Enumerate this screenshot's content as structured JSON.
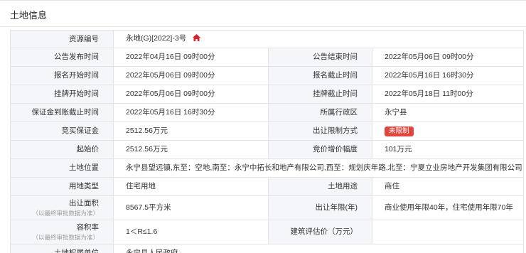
{
  "page": {
    "title": "土地信息"
  },
  "rows": [
    {
      "l1": "资源编号",
      "v1": "永地(G)[2022]-3号"
    },
    {
      "l1": "公告发布时间",
      "v1": "2022年04月16日 09时00分",
      "l2": "公告结束时间",
      "v2": "2022年05月06日 09时00分"
    },
    {
      "l1": "报名开始时间",
      "v1": "2022年05月06日 09时00分",
      "l2": "报名截止时间",
      "v2": "2022年05月16日 16时30分"
    },
    {
      "l1": "挂牌开始时间",
      "v1": "2022年05月06日 09时00分",
      "l2": "挂牌截止时间",
      "v2": "2022年05月18日 11时00分"
    },
    {
      "l1": "保证金到账截止时间",
      "v1": "2022年05月16日 16时30分",
      "l2": "所属行政区",
      "v2": "永宁县"
    },
    {
      "l1": "竞买保证金",
      "v1": "2512.56万元",
      "l2": "出让限制方式",
      "v2": "未限制"
    },
    {
      "l1": "起始价",
      "v1": "2512.56万元",
      "l2": "竞价增价幅度",
      "v2": "101万元"
    },
    {
      "l1": "土地位置",
      "v1": "永宁县望远镇,东至：空地,南至：永宁中拓长和地产有限公司,西至：规划庆年路,北至：宁夏立业房地产开发集团有限公司"
    },
    {
      "l1": "用地类型",
      "v1": "住宅用地",
      "l2": "土地用途",
      "v2": "商住"
    },
    {
      "l1": "出让面积",
      "n1": "（以最终审批数据为准）",
      "v1": "8567.5平方米",
      "l2": "出让年限(年)",
      "v2": "商业使用年限40年，住宅使用年限70年"
    },
    {
      "l1": "容积率",
      "n1": "（以最终审批数据为准）",
      "v1": "1＜R≤1.6",
      "l2": "建筑评估价（万元）",
      "v2": ""
    },
    {
      "l1": "土地权属单位",
      "v1": "永宁县人民政府"
    }
  ],
  "icons": {
    "resource_code": "home-icon"
  },
  "colors": {
    "label_bg": "#f4f6f9",
    "border": "#e3e3e3",
    "badge": "#e0463e",
    "home_icon": "#d9232d"
  }
}
